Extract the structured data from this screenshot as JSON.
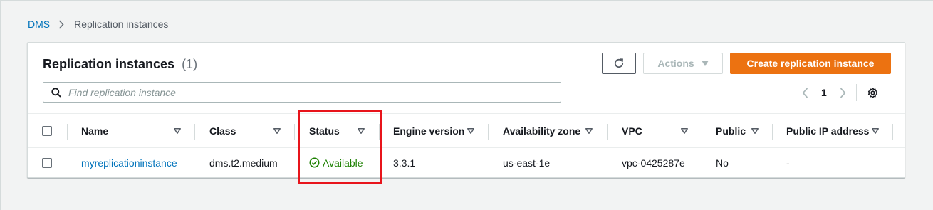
{
  "breadcrumb": {
    "root": "DMS",
    "current": "Replication instances"
  },
  "panel": {
    "title": "Replication instances",
    "count": "(1)"
  },
  "toolbar": {
    "actions_label": "Actions",
    "create_label": "Create replication instance"
  },
  "search": {
    "placeholder": "Find replication instance",
    "value": ""
  },
  "pagination": {
    "current_page": "1"
  },
  "table": {
    "columns": [
      "Name",
      "Class",
      "Status",
      "Engine version",
      "Availability zone",
      "VPC",
      "Public",
      "Public IP address"
    ],
    "rows": [
      {
        "name": "myreplicationinstance",
        "class": "dms.t2.medium",
        "status": "Available",
        "engine_version": "3.3.1",
        "availability_zone": "us-east-1e",
        "vpc": "vpc-0425287e",
        "public": "No",
        "public_ip": "-"
      }
    ]
  },
  "colors": {
    "link": "#0073bb",
    "primary_button": "#ec7211",
    "status_available": "#1d8102",
    "highlight_box": "#e8141b"
  },
  "icons": [
    "chevron-right-icon",
    "refresh-icon",
    "caret-down-icon",
    "search-icon",
    "chevron-left-icon",
    "gear-icon",
    "sort-caret-icon",
    "check-circle-icon"
  ]
}
